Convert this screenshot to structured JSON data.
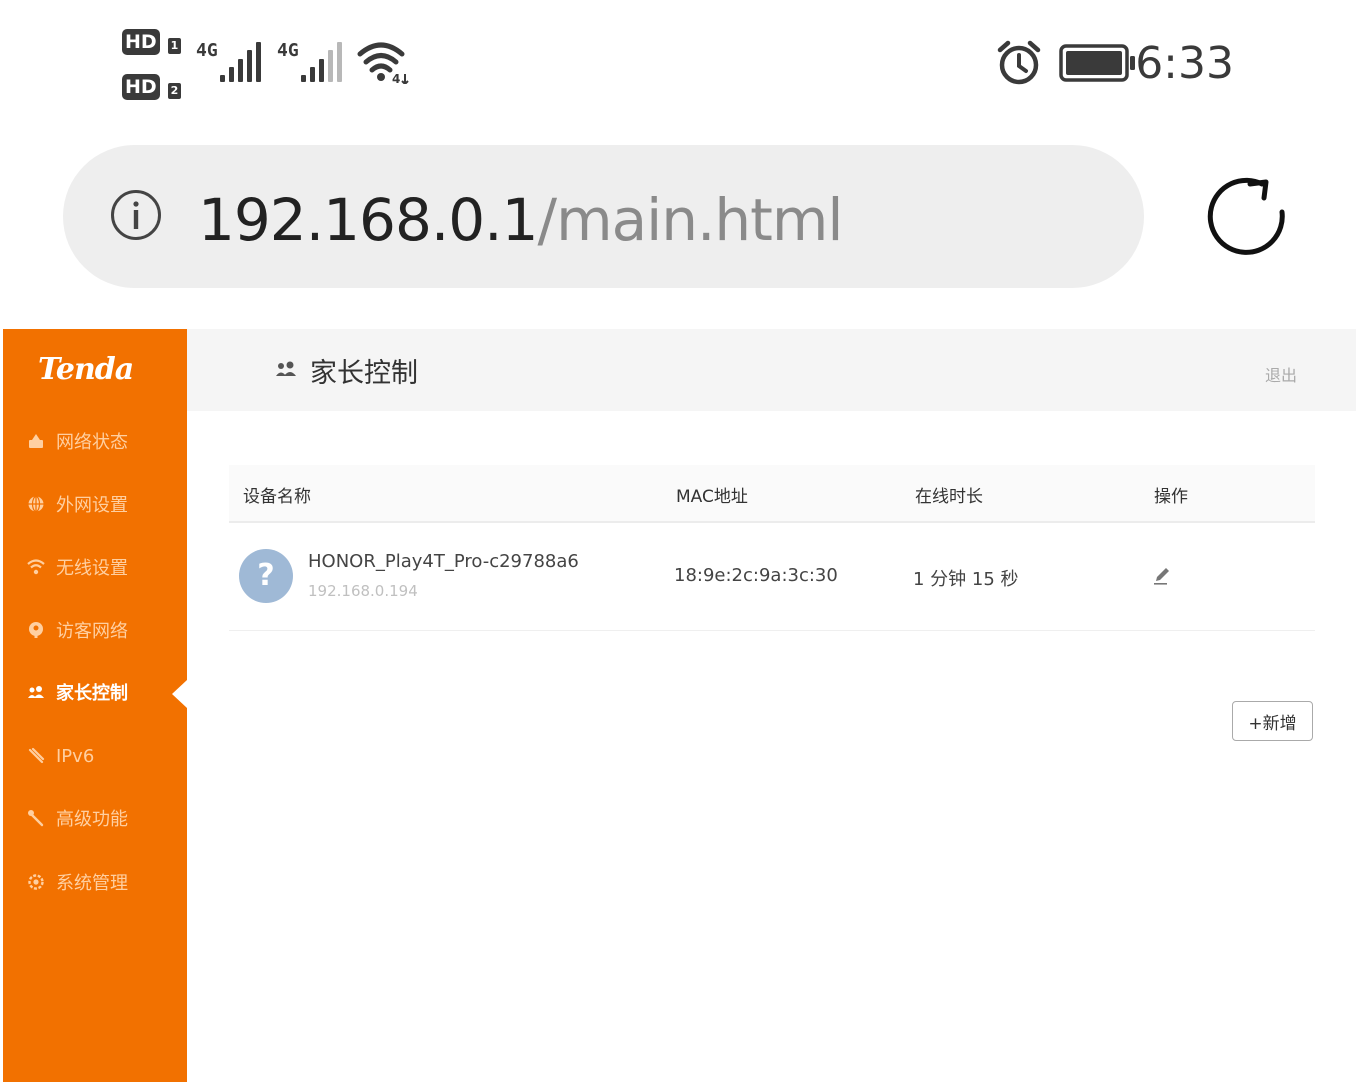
{
  "status_bar": {
    "sim1_badge": "HD",
    "sim1_index": "1",
    "sim2_badge": "HD",
    "sim2_index": "2",
    "sim1_network": "4G",
    "sim2_network": "4G",
    "wifi_tag": "4",
    "time": "6:33",
    "icons": [
      "signal-icon",
      "wifi-icon",
      "alarm-icon",
      "battery-icon"
    ]
  },
  "browser": {
    "url_host": "192.168.0.1",
    "url_path": "/main.html",
    "icons": [
      "info-icon",
      "reload-icon"
    ]
  },
  "router": {
    "brand": "Tenda",
    "accent_color": "#f27100",
    "page_title": "家长控制",
    "logout_label": "退出",
    "nav": [
      {
        "label": "网络状态",
        "icon": "network-status-icon"
      },
      {
        "label": "外网设置",
        "icon": "globe-icon"
      },
      {
        "label": "无线设置",
        "icon": "wifi-icon"
      },
      {
        "label": "访客网络",
        "icon": "guest-icon"
      },
      {
        "label": "家长控制",
        "icon": "family-icon",
        "active": true
      },
      {
        "label": "IPv6",
        "icon": "ipv6-icon"
      },
      {
        "label": "高级功能",
        "icon": "tools-icon"
      },
      {
        "label": "系统管理",
        "icon": "gear-icon"
      }
    ],
    "table": {
      "headers": [
        "设备名称",
        "MAC地址",
        "在线时长",
        "操作"
      ],
      "rows": [
        {
          "avatar": "?",
          "device_name": "HONOR_Play4T_Pro-c29788a6",
          "ip": "192.168.0.194",
          "mac": "18:9e:2c:9a:3c:30",
          "online_time": "1 分钟 15 秒",
          "action_icon": "edit-icon"
        }
      ]
    },
    "add_button_label": "+新增"
  }
}
